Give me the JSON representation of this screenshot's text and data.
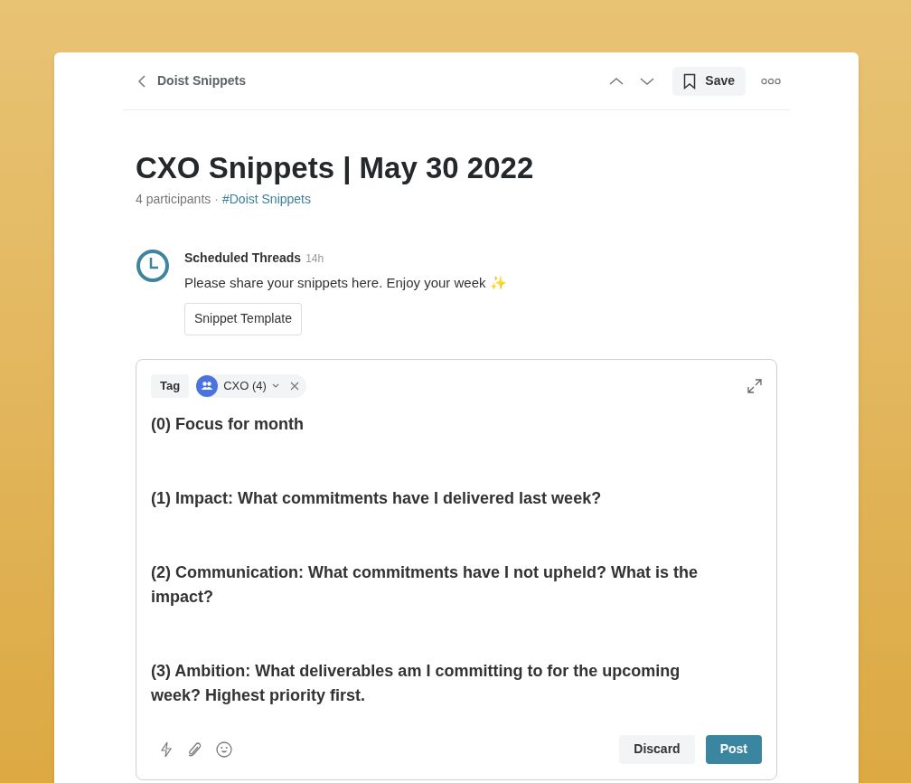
{
  "header": {
    "back_label": "Doist Snippets",
    "save_label": "Save"
  },
  "thread": {
    "title": "CXO Snippets | May 30 2022",
    "participants": "4 participants",
    "separator": "·",
    "channel": "#Doist Snippets"
  },
  "message": {
    "author": "Scheduled Threads",
    "time": "14h",
    "text": "Please share your snippets here. Enjoy your week ✨",
    "attachment": "Snippet Template"
  },
  "composer": {
    "tag_label": "Tag",
    "group": "CXO (4)",
    "paragraphs": [
      "(0) Focus for month",
      "(1) Impact: What commitments have I delivered last week?",
      "(2) Communication: What commitments have I not upheld? What is the impact?",
      "(3) Ambition: What deliverables am I committing to for the upcoming week? Highest priority first."
    ],
    "buttons": [
      {
        "label": "Discard",
        "kind": "secondary"
      },
      {
        "label": "Post",
        "kind": "primary"
      }
    ]
  }
}
